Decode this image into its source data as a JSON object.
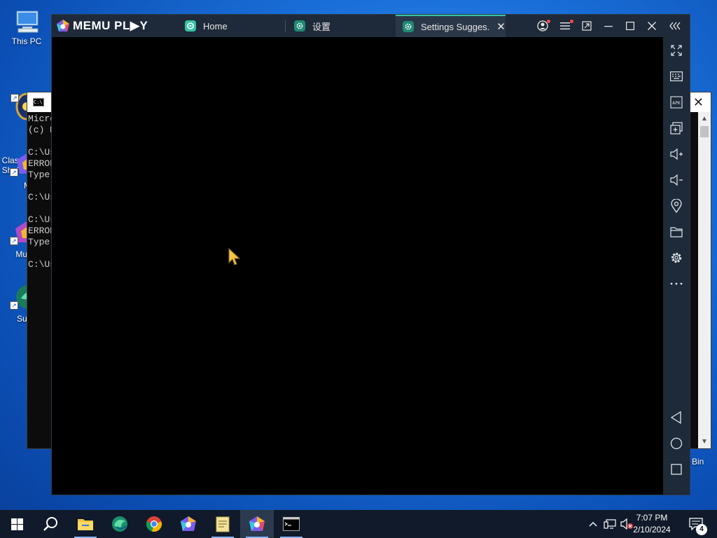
{
  "desktop": {
    "icons": [
      {
        "label": "This PC"
      },
      {
        "label": "Classic\nShell C"
      },
      {
        "label": "ME"
      },
      {
        "label": "Multi-"
      },
      {
        "label": "Super"
      }
    ],
    "recycle_bin_label": "Bin"
  },
  "cmd": {
    "lines": [
      "Micro",
      "(c) M",
      "",
      "C:\\Us",
      "ERROR",
      "Type",
      "",
      "C:\\Us",
      "",
      "C:\\Us",
      "ERROR",
      "Type",
      "",
      "C:\\Us"
    ]
  },
  "memu": {
    "logo": "MEMU PL▶Y",
    "tabs": [
      {
        "label": "Home",
        "icon": "memu-home-icon"
      },
      {
        "label": "设置",
        "icon": "settings-app-icon"
      },
      {
        "label": "Settings Sugges.",
        "icon": "settings-app-icon",
        "active": true
      }
    ],
    "title_controls": [
      "account-icon",
      "menu-icon",
      "screen-fit-icon",
      "minimize-icon",
      "maximize-icon",
      "close-icon",
      "collapse-sidebar-icon"
    ],
    "sidebar": [
      "fullscreen-icon",
      "keyboard-mapping-icon",
      "apk-install-icon",
      "multi-window-icon",
      "volume-up-icon",
      "volume-down-icon",
      "location-icon",
      "shared-folder-icon",
      "settings-icon",
      "more-icon",
      "back-icon",
      "home-icon",
      "recents-icon"
    ]
  },
  "taskbar": {
    "apps": [
      "start-icon",
      "search-icon",
      "file-explorer-icon",
      "edge-icon",
      "chrome-icon",
      "memu-multi-icon",
      "notepad-icon",
      "memu-icon",
      "cmd-icon"
    ],
    "time": "7:07 PM",
    "date": "2/10/2024",
    "notification_count": "4"
  },
  "colors": {
    "accent_teal": "#35c3a3",
    "memu_bar": "#1e2a39",
    "taskbar": "#101a2a"
  }
}
